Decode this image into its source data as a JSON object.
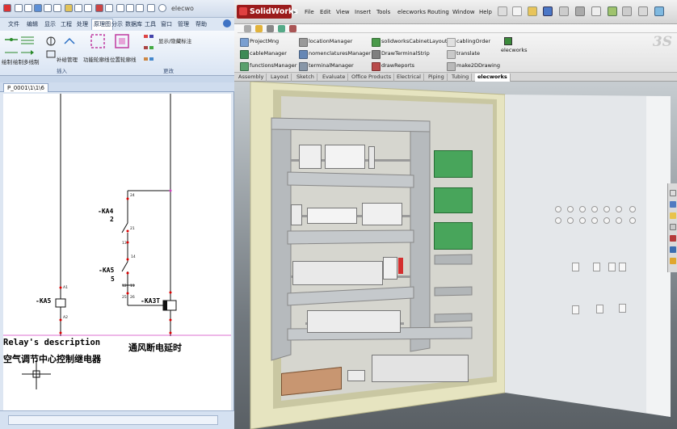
{
  "left_app": {
    "title_fragment": "elecwo",
    "ribbon_tabs": [
      "文件",
      "编辑",
      "显示",
      "工程",
      "处理",
      "原理图",
      "分示",
      "数据库",
      "工具",
      "窗口",
      "管理",
      "帮助"
    ],
    "active_tab": "原理图",
    "ribbon_buttons": {
      "draw_single": "绘制",
      "draw_multi": "绘制多线制",
      "cable_mgmt": "补给管理",
      "func_outline": "功能轮廓线",
      "location_outline": "位置轮廓线",
      "show_hide_annot": "显示/隐藏标注"
    },
    "group_insert": "插入",
    "group_modify": "更改",
    "document_tab": "P_0001\\1\\1\\6",
    "schematic": {
      "contact1_tag": "-KA4",
      "contact1_num": "2",
      "contact2_tag": "-KA5",
      "contact2_num": "5",
      "coil1_tag": "-KA5",
      "coil2_tag": "-KA3T",
      "pin_24": "24",
      "pin_21": "21",
      "pin_13": "13",
      "pin_14": "14",
      "pin_12": "12",
      "pin_11": "11",
      "pin_25": "25",
      "pin_26": "26",
      "pin_a1": "A1",
      "pin_a2": "A2",
      "desc_en": "Relay's description",
      "desc_cn": "空气调节中心控制继电器",
      "desc_right": "通风断电延时"
    }
  },
  "right_app": {
    "brand": "SolidWorks",
    "menu": [
      "File",
      "Edit",
      "View",
      "Insert",
      "Tools",
      "elecworks",
      "Routing",
      "Window",
      "Help"
    ],
    "commands": [
      [
        "ProjectMng",
        "locationManager",
        "solidworksCabinetLayout",
        "cablingOrder"
      ],
      [
        "cableManager",
        "nomenclaturesManager",
        "DrawTerminalStrip",
        "translate"
      ],
      [
        "functionsManager",
        "terminalManager",
        "drawReports",
        "make2DDrawing"
      ]
    ],
    "elecworks_cmd": "elecworks",
    "tabs": [
      "Assembly",
      "Layout",
      "Sketch",
      "Evaluate",
      "Office Products",
      "Electrical",
      "Piping",
      "Tubing",
      "elecworks"
    ],
    "active_tab": "elecworks"
  },
  "colors": {
    "cabinet_outer": "#e8e7c4",
    "door": "#e3e6ea",
    "rail": "#bfc3c7",
    "green_module": "#47a35a",
    "wire_duct": "#a9adb0"
  }
}
